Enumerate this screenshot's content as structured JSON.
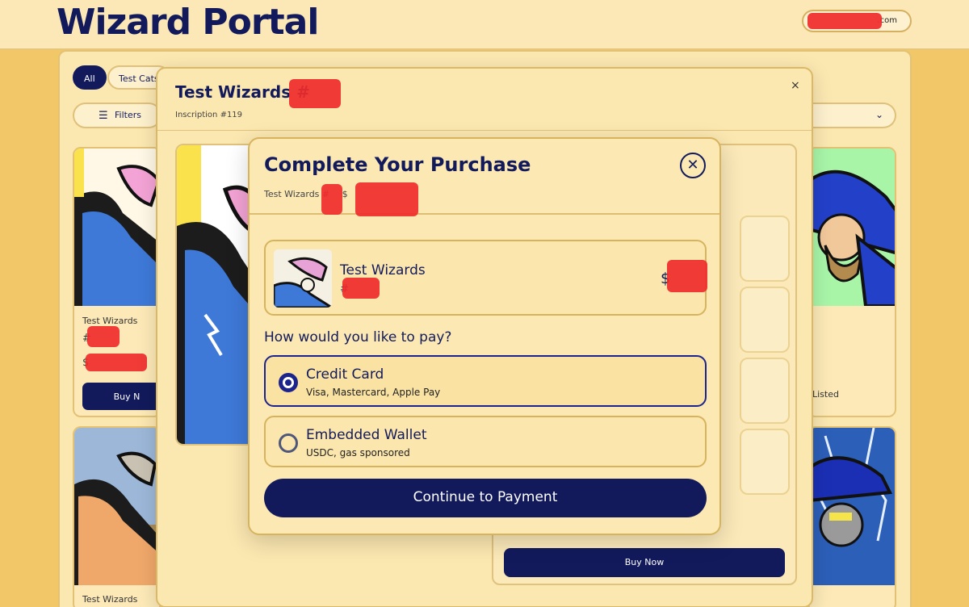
{
  "header": {
    "brand": "Wizard Portal",
    "account_suffix": ".com"
  },
  "gallery": {
    "chips": [
      "All",
      "Test Cats"
    ],
    "filters_label": "Filters",
    "filters_icon": "sliders-icon",
    "sort_chevron": "⌄",
    "cards": [
      {
        "collection": "Test Wizards",
        "number_prefix": "#",
        "price_prefix": "$",
        "buy_label": "Buy N"
      },
      {
        "status": "Listed"
      },
      {
        "collection": "Test Wizards"
      }
    ]
  },
  "detail_modal": {
    "title": "Test Wizards #",
    "subtitle": "Inscription #119",
    "close_glyph": "×",
    "buy_label": "Buy Now"
  },
  "purchase_modal": {
    "title": "Complete Your Purchase",
    "subtitle_prefix": "Test Wizards #",
    "subtitle_price_prefix": "$",
    "close_glyph": "✕",
    "item": {
      "name": "Test Wizards",
      "number_prefix": "#",
      "price_prefix": "$"
    },
    "pay_question": "How would you like to pay?",
    "options": [
      {
        "title": "Credit Card",
        "description": "Visa, Mastercard, Apple Pay",
        "selected": true
      },
      {
        "title": "Embedded Wallet",
        "description": "USDC, gas sponsored",
        "selected": false
      }
    ],
    "continue_label": "Continue to Payment"
  },
  "colors": {
    "navy": "#121a5c",
    "cream": "#fbe8b3",
    "gold": "#f2c768",
    "redaction": "#ef2b2b"
  }
}
